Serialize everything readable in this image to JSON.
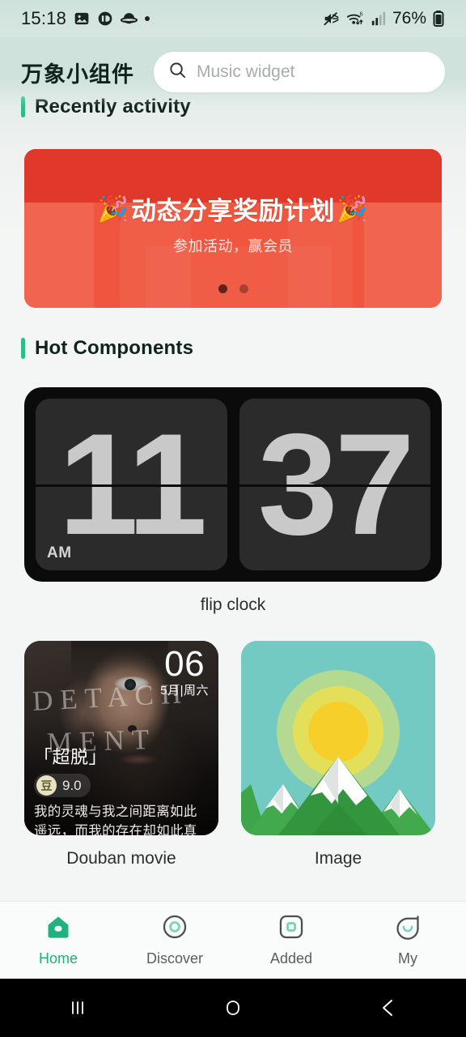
{
  "status_bar": {
    "time": "15:18",
    "battery_percent": "76%",
    "icons": [
      "image-icon",
      "app-notification-icon",
      "planet-icon",
      "dot-icon",
      "mute-icon",
      "wifi-6-icon",
      "signal-icon",
      "battery-icon"
    ]
  },
  "header": {
    "app_title": "万象小组件",
    "search": {
      "placeholder": "Music widget",
      "icon": "search-icon"
    }
  },
  "sections": {
    "recently_activity": "Recently activity",
    "hot_components": "Hot Components"
  },
  "banner": {
    "title": "动态分享奖励计划",
    "emoji_left": "🎉",
    "emoji_right": "🎉",
    "subtitle": "参加活动，赢会员",
    "dots_total": 2,
    "dot_active_index": 0,
    "background_color": "#f0563f",
    "top_band_color": "#e0392c"
  },
  "widgets": {
    "flip_clock": {
      "label": "flip clock",
      "hour": "11",
      "minute": "37",
      "meridiem": "AM",
      "card_color": "#2b2b2b",
      "frame_color": "#0b0b0b",
      "digit_color": "#c9c9c9"
    },
    "douban_movie": {
      "label": "Douban movie",
      "day": "06",
      "month_weekday": "5月|周六",
      "movie_title": "「超脱」",
      "poster_text_line1": "DETACH",
      "poster_text_line2": "MENT",
      "rating": "9.0",
      "rating_badge": "豆",
      "quote": "我的灵魂与我之间距离如此遥远，而我的存在却如此真实。"
    },
    "image": {
      "label": "Image",
      "illustration": "mountains-with-sun",
      "sky_color": "#73cac2",
      "sun_color": "#f6cf2a",
      "mountain_color": "#3fa54a",
      "snow_color": "#ffffff"
    }
  },
  "tab_bar": {
    "items": [
      {
        "label": "Home",
        "icon": "home-icon",
        "active": true
      },
      {
        "label": "Discover",
        "icon": "compass-icon",
        "active": false
      },
      {
        "label": "Added",
        "icon": "square-icon",
        "active": false
      },
      {
        "label": "My",
        "icon": "profile-icon",
        "active": false
      }
    ],
    "active_color": "#21b07f",
    "inactive_color": "#58605e"
  },
  "system_nav": {
    "recents_label": "recents",
    "home_label": "home",
    "back_label": "back"
  },
  "theme": {
    "accent_green": "#2bbd8c",
    "page_bg": "#f4f6f5",
    "header_bg": "#cfe2dc"
  }
}
